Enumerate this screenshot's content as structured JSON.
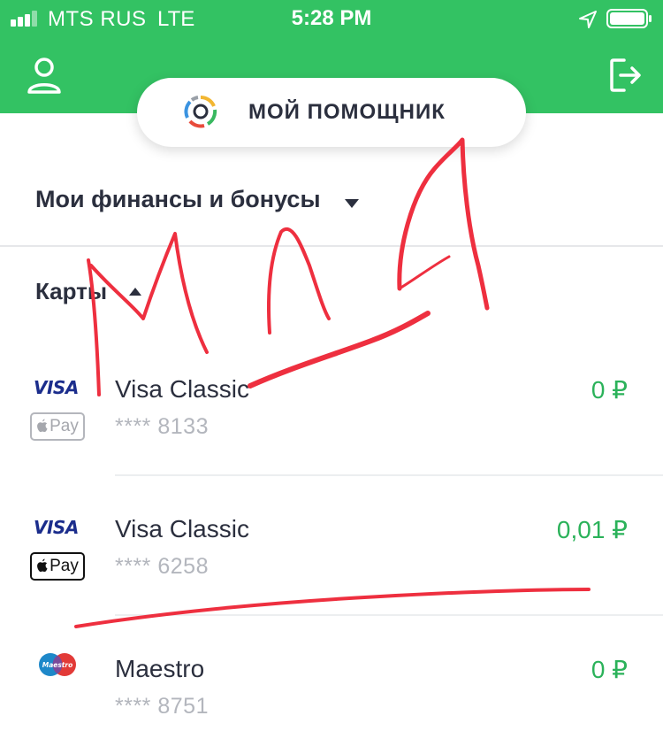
{
  "status_bar": {
    "carrier": "MTS RUS",
    "network": "LTE",
    "time": "5:28 PM",
    "signal_icon": "signal-bars-icon",
    "location_icon": "location-arrow-icon",
    "battery_icon": "battery-icon"
  },
  "header": {
    "color": "#33c263",
    "profile_icon": "user-icon",
    "logout_icon": "logout-icon"
  },
  "assistant": {
    "label": "МОЙ ПОМОЩНИК",
    "icon": "assistant-ring-icon"
  },
  "finances": {
    "title": "Мои финансы и бонусы"
  },
  "cards_section": {
    "title": "Карты",
    "items": [
      {
        "name": "Visa Classic",
        "number": "**** 8133",
        "amount": "0 ₽",
        "logo_text": "VISA",
        "wallet": "Pay",
        "wallet_active": false
      },
      {
        "name": "Visa Classic",
        "number": "**** 6258",
        "amount": "0,01 ₽",
        "logo_text": "VISA",
        "wallet": "Pay",
        "wallet_active": true
      },
      {
        "name": "Maestro",
        "number": "**** 8751",
        "amount": "0 ₽",
        "logo_text": "Maestro"
      }
    ]
  },
  "colors": {
    "accent_green": "#33c263",
    "amount_green": "#2bb25a",
    "scribble_red": "#ee2f3f"
  }
}
